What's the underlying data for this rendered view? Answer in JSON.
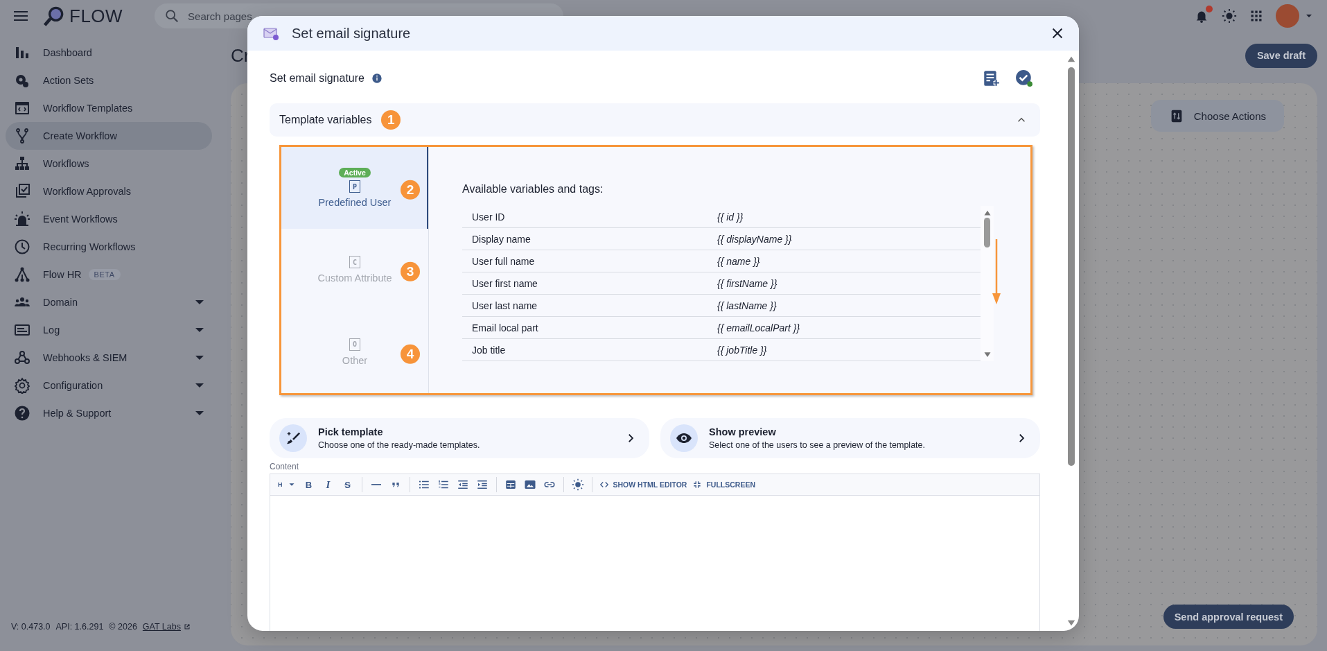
{
  "app": {
    "name": "FLOW",
    "search_placeholder": "Search pages",
    "has_notifications": true
  },
  "sidebar": {
    "items": [
      {
        "label": "Dashboard",
        "selected": false,
        "expandable": false
      },
      {
        "label": "Action Sets",
        "selected": false,
        "expandable": false
      },
      {
        "label": "Workflow Templates",
        "selected": false,
        "expandable": false
      },
      {
        "label": "Create Workflow",
        "selected": true,
        "expandable": false
      },
      {
        "label": "Workflows",
        "selected": false,
        "expandable": false
      },
      {
        "label": "Workflow Approvals",
        "selected": false,
        "expandable": false
      },
      {
        "label": "Event Workflows",
        "selected": false,
        "expandable": false
      },
      {
        "label": "Recurring Workflows",
        "selected": false,
        "expandable": false
      },
      {
        "label": "Flow HR",
        "badge": "BETA",
        "selected": false,
        "expandable": false
      },
      {
        "label": "Domain",
        "selected": false,
        "expandable": true
      },
      {
        "label": "Log",
        "selected": false,
        "expandable": true
      },
      {
        "label": "Webhooks & SIEM",
        "selected": false,
        "expandable": true
      },
      {
        "label": "Configuration",
        "selected": false,
        "expandable": true
      },
      {
        "label": "Help & Support",
        "selected": false,
        "expandable": true
      }
    ],
    "footer": {
      "version": "V: 0.473.0",
      "api": "API: 1.6.291",
      "copyright": "© 2026",
      "link": "GAT Labs"
    }
  },
  "page": {
    "title": "Cr",
    "save_button": "Save draft",
    "choose_actions": "Choose Actions",
    "send_button": "Send approval request"
  },
  "dialog": {
    "title": "Set email signature",
    "heading": "Set email signature",
    "accordion": {
      "title": "Template variables",
      "expanded": true,
      "callout": "1"
    },
    "variable_tabs": [
      {
        "letter": "P",
        "label": "Predefined User",
        "selected": true,
        "badge": "Active",
        "callout": "2"
      },
      {
        "letter": "C",
        "label": "Custom Attribute",
        "selected": false,
        "callout": "3"
      },
      {
        "letter": "O",
        "label": "Other",
        "selected": false,
        "callout": "4"
      }
    ],
    "variables_heading": "Available variables and tags:",
    "variables": [
      {
        "name": "User ID",
        "tag": "{{ id }}"
      },
      {
        "name": "Display name",
        "tag": "{{ displayName }}"
      },
      {
        "name": "User full name",
        "tag": "{{ name }}"
      },
      {
        "name": "User first name",
        "tag": "{{ firstName }}"
      },
      {
        "name": "User last name",
        "tag": "{{ lastName }}"
      },
      {
        "name": "Email local part",
        "tag": "{{ emailLocalPart }}"
      },
      {
        "name": "Job title",
        "tag": "{{ jobTitle }}"
      }
    ],
    "actions": [
      {
        "title": "Pick template",
        "description": "Choose one of the ready-made templates."
      },
      {
        "title": "Show preview",
        "description": "Select one of the users to see a preview of the template."
      }
    ],
    "content_label": "Content",
    "toolbar": {
      "heading": "H",
      "bold": "B",
      "italic": "I",
      "strike": "S",
      "html_button": "SHOW HTML EDITOR",
      "fullscreen_button": "FULLSCREEN"
    }
  }
}
